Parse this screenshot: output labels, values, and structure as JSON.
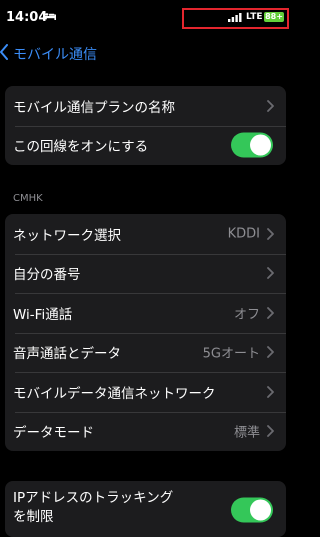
{
  "status_bar": {
    "time": "14:04",
    "network": "LTE",
    "battery": "88+",
    "colors": {
      "battery": "#63d03a",
      "highlight": "#e4262e"
    }
  },
  "nav": {
    "back_label": "モバイル通信",
    "accent_color": "#3b8df7"
  },
  "group1": {
    "plan_name_label": "モバイル通信プランの名称",
    "line_on_label": "この回線をオンにする",
    "line_on_value": true
  },
  "section_header": "CMHK",
  "group2": {
    "items": [
      {
        "label": "ネットワーク選択",
        "value": "KDDI"
      },
      {
        "label": "自分の番号",
        "value": ""
      },
      {
        "label": "Wi-Fi通話",
        "value": "オフ"
      },
      {
        "label": "音声通話とデータ",
        "value": "5Gオート"
      },
      {
        "label": "モバイルデータ通信ネットワーク",
        "value": ""
      },
      {
        "label": "データモード",
        "value": "標準"
      }
    ]
  },
  "group3": {
    "ip_tracking_label_line1": "IPアドレスのトラッキング",
    "ip_tracking_label_line2": "を制限",
    "ip_tracking_value": true,
    "toggle_color": "#34c759"
  },
  "icons": [
    "bed-icon",
    "signal-icon",
    "battery-icon",
    "back-chevron-icon",
    "chevron-right-icon"
  ]
}
